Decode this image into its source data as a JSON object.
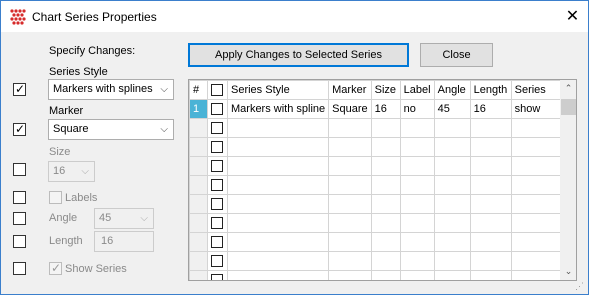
{
  "window": {
    "title": "Chart Series Properties",
    "close_glyph": "✕"
  },
  "left": {
    "specify_heading": "Specify Changes:",
    "series_style_label": "Series Style",
    "series_style_value": "Markers with splines",
    "marker_label": "Marker",
    "marker_value": "Square",
    "size_label": "Size",
    "size_value": "16",
    "labels_label": "Labels",
    "angle_label": "Angle",
    "angle_value": "45",
    "length_label": "Length",
    "length_value": "16",
    "show_series_label": "Show Series",
    "checks": {
      "series_style": true,
      "marker": true,
      "size": false,
      "labels": false,
      "angle": false,
      "length": false,
      "show_series": false
    }
  },
  "buttons": {
    "apply": "Apply Changes to Selected Series",
    "close": "Close"
  },
  "grid": {
    "columns": [
      "#",
      "",
      "Series Style",
      "Marker",
      "Size",
      "Label",
      "Angle",
      "Length",
      "Series"
    ],
    "rows": [
      {
        "num": "1",
        "style": "Markers with spline",
        "marker": "Square",
        "size": "16",
        "label": "no",
        "angle": "45",
        "length": "16",
        "series": "show"
      }
    ],
    "empty_rows": 9
  },
  "icons": {
    "app": "chart-grid-icon",
    "close": "close-icon",
    "dropdown": "chevron-down-icon"
  }
}
